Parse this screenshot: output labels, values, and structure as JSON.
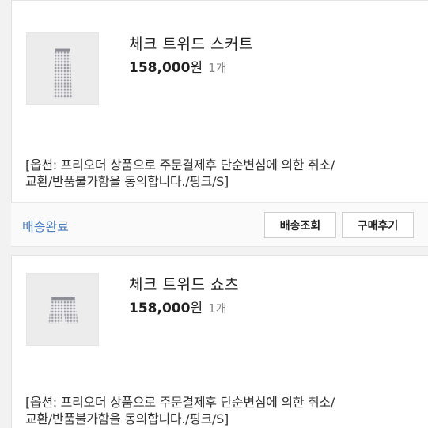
{
  "orders": [
    {
      "product_name": "체크 트위드 스커트",
      "price": "158,000",
      "currency": "원",
      "quantity": "1개",
      "option_line1": "[옵션: 프리오더 상품으로 주문결제후 단순변심에 의한 취소/",
      "option_line2": "교환/반품불가함을 동의합니다./핑크/S]",
      "thumb_icon": "skirt-icon"
    },
    {
      "product_name": "체크 트위드 쇼츠",
      "price": "158,000",
      "currency": "원",
      "quantity": "1개",
      "option_line1": "[옵션: 프리오더 상품으로 주문결제후 단순변심에 의한 취소/",
      "option_line2": "교환/반품불가함을 동의합니다./핑크/S]",
      "thumb_icon": "shorts-icon"
    }
  ],
  "status_bar": {
    "status_label": "배송완료",
    "track_button": "배송조회",
    "review_button": "구매후기"
  },
  "colors": {
    "status_blue": "#4a7fc1",
    "page_bg": "#f2f2f2"
  }
}
